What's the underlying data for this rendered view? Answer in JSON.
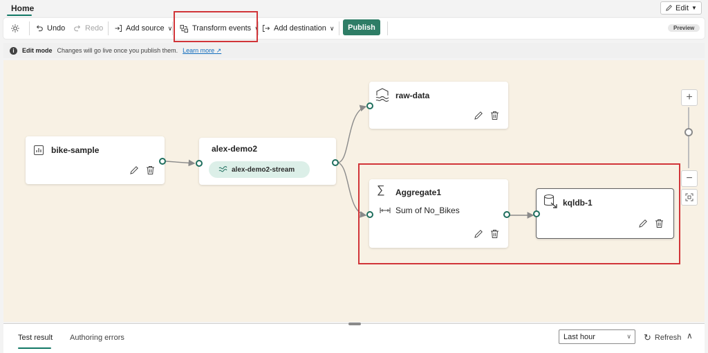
{
  "tabs": {
    "home": "Home",
    "edit": "Edit"
  },
  "toolbar": {
    "undo": "Undo",
    "redo": "Redo",
    "add_source": "Add source",
    "transform_events": "Transform events",
    "add_destination": "Add destination",
    "publish": "Publish",
    "preview": "Preview"
  },
  "infobar": {
    "title": "Edit mode",
    "message": "Changes will go live once you publish them.",
    "link": "Learn more"
  },
  "nodes": {
    "source": {
      "title": "bike-sample"
    },
    "stream": {
      "title": "alex-demo2",
      "pill": "alex-demo2-stream"
    },
    "rawdata": {
      "title": "raw-data"
    },
    "aggregate": {
      "title": "Aggregate1",
      "detail": "Sum of No_Bikes"
    },
    "kql": {
      "title": "kqldb-1"
    }
  },
  "bottom": {
    "tabs": [
      "Test result",
      "Authoring errors"
    ],
    "time_range": "Last hour",
    "refresh": "Refresh"
  },
  "colors": {
    "accent": "#117865",
    "publish": "#2e7d66",
    "highlight": "#d13438",
    "canvas": "#f8f1e4"
  }
}
